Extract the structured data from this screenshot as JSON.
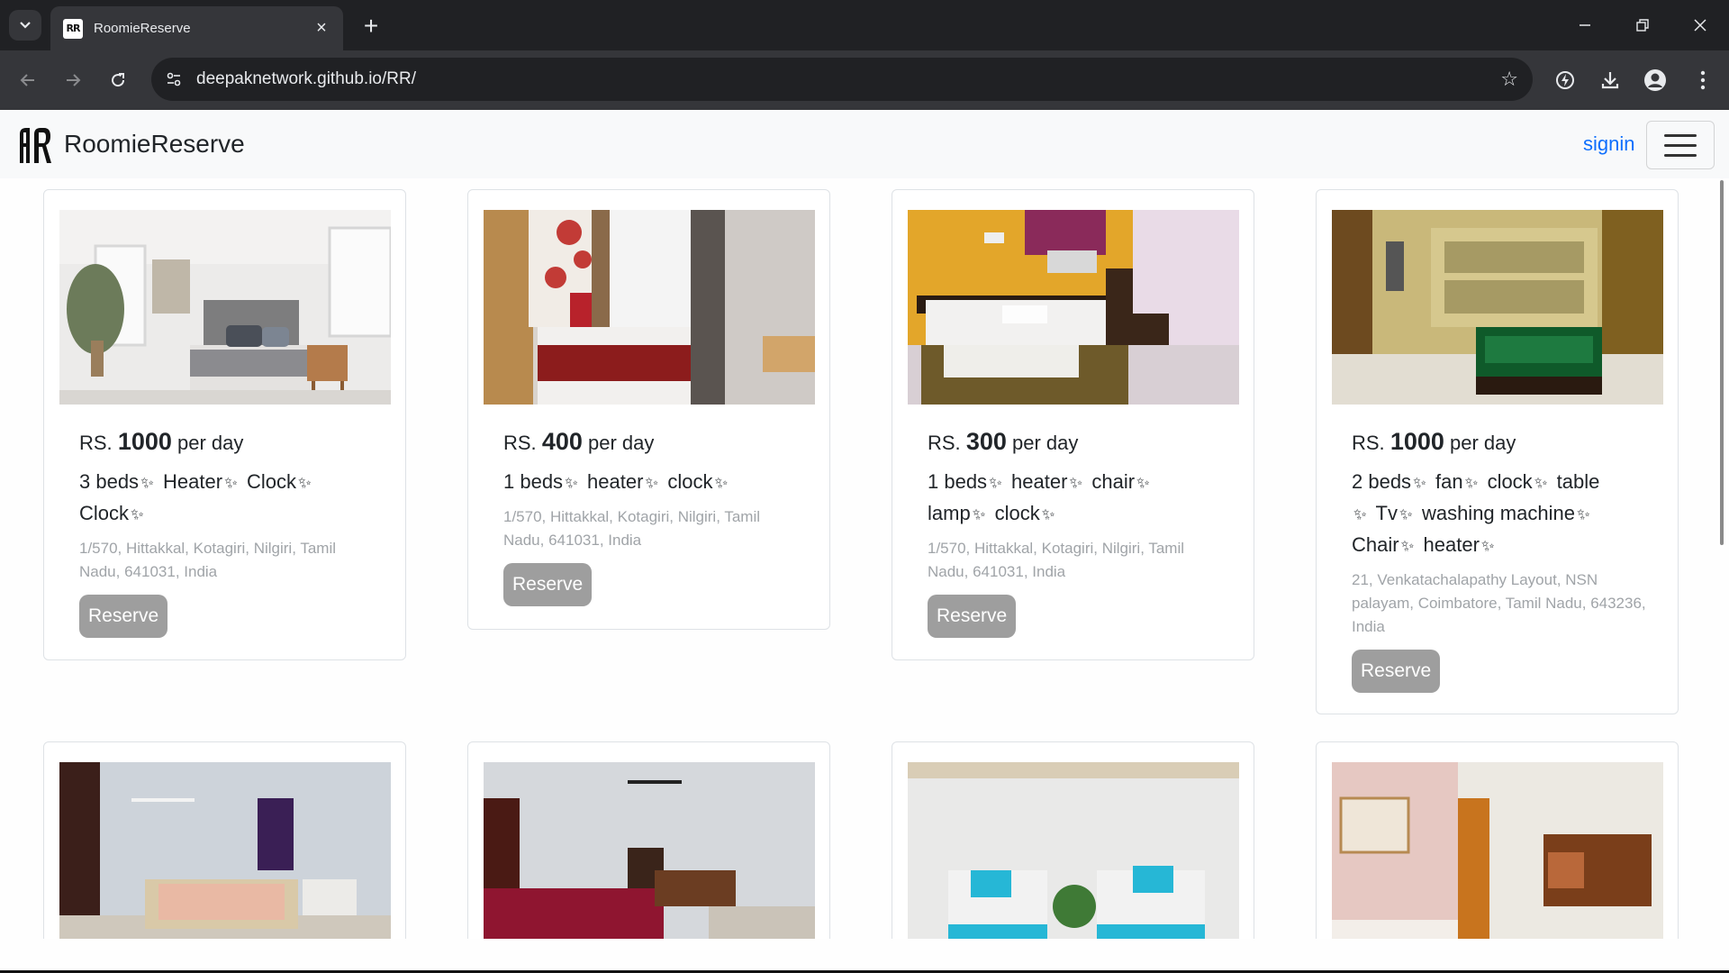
{
  "browser": {
    "tab_title": "RoomieReserve",
    "url": "deepaknetwork.github.io/RR/"
  },
  "navbar": {
    "brand": "RoomieReserve",
    "signin": "signin"
  },
  "listings": [
    {
      "currency": "RS.",
      "price": "1000",
      "unit": "per day",
      "features": [
        "3 beds",
        "Heater",
        "Clock",
        "Clock"
      ],
      "address": "1/570, Hittakkal, Kotagiri, Nilgiri, Tamil Nadu, 641031, India",
      "button": "Reserve"
    },
    {
      "currency": "RS.",
      "price": "400",
      "unit": "per day",
      "features": [
        "1 beds",
        "heater",
        "clock"
      ],
      "address": "1/570, Hittakkal, Kotagiri, Nilgiri, Tamil Nadu, 641031, India",
      "button": "Reserve"
    },
    {
      "currency": "RS.",
      "price": "300",
      "unit": "per day",
      "features": [
        "1 beds",
        "heater",
        "chair",
        "lamp",
        "clock"
      ],
      "address": "1/570, Hittakkal, Kotagiri, Nilgiri, Tamil Nadu, 641031, India",
      "button": "Reserve"
    },
    {
      "currency": "RS.",
      "price": "1000",
      "unit": "per day",
      "features": [
        "2 beds",
        "fan",
        "clock",
        "table",
        "Tv",
        "washing machine",
        "Chair",
        "heater"
      ],
      "address": "21, Venkatachalapathy Layout, NSN palayam, Coimbatore, Tamil Nadu, 643236, India",
      "button": "Reserve"
    }
  ],
  "colors": {
    "link": "#0d6efd",
    "reserve_button": "#9e9e9e",
    "navbar_bg": "#f8f9fa"
  }
}
